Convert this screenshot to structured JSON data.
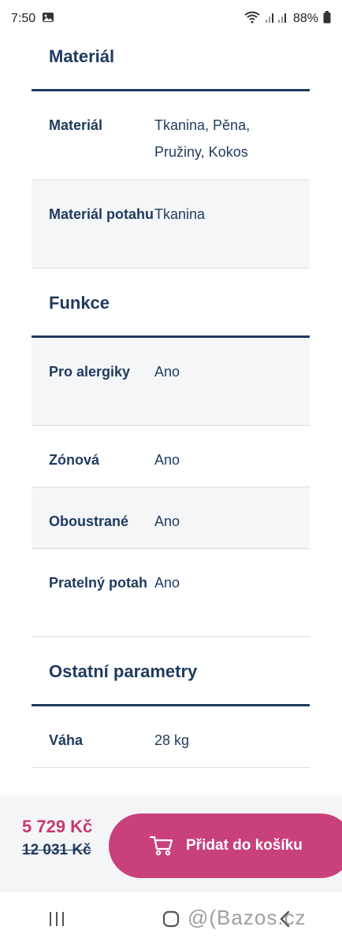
{
  "status_bar": {
    "time": "7:50",
    "battery": "88%"
  },
  "sections": [
    {
      "title": "Materiál",
      "rows": [
        {
          "label": "Materiál",
          "value": "Tkanina, Pěna, Pružiny, Kokos"
        },
        {
          "label": "Materiál potahu",
          "value": "Tkanina"
        }
      ]
    },
    {
      "title": "Funkce",
      "rows": [
        {
          "label": "Pro alergiky",
          "value": "Ano"
        },
        {
          "label": "Zónová",
          "value": "Ano"
        },
        {
          "label": "Oboustrané",
          "value": "Ano"
        },
        {
          "label": "Pratelný potah",
          "value": "Ano"
        }
      ]
    },
    {
      "title": "Ostatní parametry",
      "rows": [
        {
          "label": "Váha",
          "value": "28 kg"
        }
      ]
    }
  ],
  "purchase": {
    "price": "5 729 Kč",
    "old_price": "12 031 Kč",
    "button_label": "Přidat do košíku"
  },
  "watermark": "@(Bazos.cz",
  "colors": {
    "text": "#1f3a5f",
    "accent": "#c9417b",
    "price": "#c53a73",
    "row_shade": "#f4f6f8"
  },
  "icons": [
    "gallery-icon",
    "wifi-icon",
    "signal-icon",
    "battery-icon",
    "cart-icon",
    "recent-apps-icon",
    "home-icon",
    "back-icon"
  ]
}
